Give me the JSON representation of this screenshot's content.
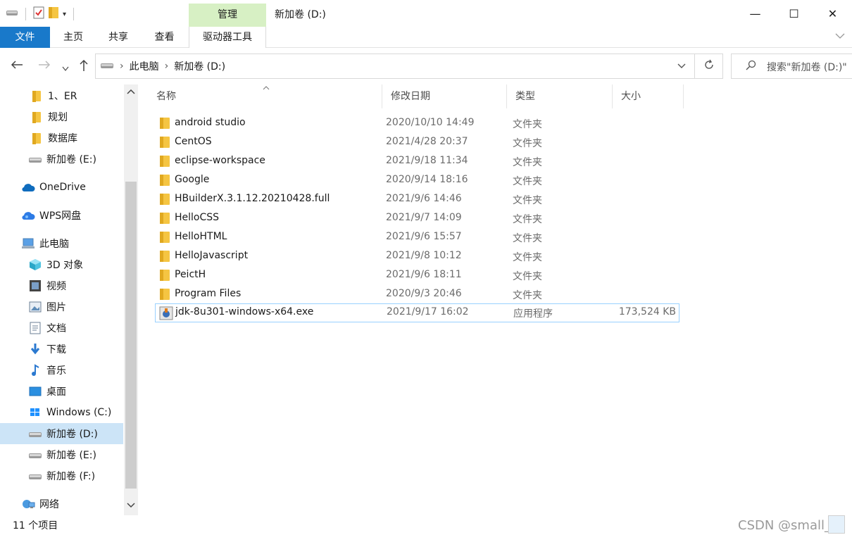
{
  "window": {
    "title": "新加卷 (D:)",
    "context_tab": "管理",
    "controls": {
      "minimize": "—",
      "maximize": "☐",
      "close": "✕"
    }
  },
  "ribbon": {
    "tabs": [
      "文件",
      "主页",
      "共享",
      "查看",
      "驱动器工具"
    ],
    "expand_icon": "chevron-down-icon"
  },
  "address": {
    "crumbs": [
      "此电脑",
      "新加卷 (D:)"
    ],
    "search_placeholder": "搜索\"新加卷 (D:)\""
  },
  "sidebar": {
    "items": [
      {
        "label": "1、ER",
        "icon": "folder-icon"
      },
      {
        "label": "规划",
        "icon": "folder-icon"
      },
      {
        "label": "数据库",
        "icon": "folder-icon"
      },
      {
        "label": "新加卷 (E:)",
        "icon": "drive-icon"
      },
      {
        "label": "OneDrive",
        "icon": "cloud-icon"
      },
      {
        "label": "WPS网盘",
        "icon": "wps-cloud-icon"
      },
      {
        "label": "此电脑",
        "icon": "computer-icon"
      },
      {
        "label": "3D 对象",
        "icon": "cube-icon"
      },
      {
        "label": "视频",
        "icon": "film-icon"
      },
      {
        "label": "图片",
        "icon": "picture-icon"
      },
      {
        "label": "文档",
        "icon": "document-icon"
      },
      {
        "label": "下载",
        "icon": "download-icon"
      },
      {
        "label": "音乐",
        "icon": "music-icon"
      },
      {
        "label": "桌面",
        "icon": "desktop-icon"
      },
      {
        "label": "Windows (C:)",
        "icon": "windows-drive-icon"
      },
      {
        "label": "新加卷 (D:)",
        "icon": "drive-icon"
      },
      {
        "label": "新加卷 (E:)",
        "icon": "drive-icon"
      },
      {
        "label": "新加卷 (F:)",
        "icon": "drive-icon"
      },
      {
        "label": "网络",
        "icon": "network-icon"
      }
    ],
    "selected_label": "新加卷 (D:)"
  },
  "columns": {
    "name": "名称",
    "modified": "修改日期",
    "type": "类型",
    "size": "大小"
  },
  "files": [
    {
      "name": "android studio",
      "modified": "2020/10/10 14:49",
      "type": "文件夹",
      "size": "",
      "icon": "folder-icon"
    },
    {
      "name": "CentOS",
      "modified": "2021/4/28 20:37",
      "type": "文件夹",
      "size": "",
      "icon": "folder-icon"
    },
    {
      "name": "eclipse-workspace",
      "modified": "2021/9/18 11:34",
      "type": "文件夹",
      "size": "",
      "icon": "folder-icon"
    },
    {
      "name": "Google",
      "modified": "2020/9/14 18:16",
      "type": "文件夹",
      "size": "",
      "icon": "folder-icon"
    },
    {
      "name": "HBuilderX.3.1.12.20210428.full",
      "modified": "2021/9/6 14:46",
      "type": "文件夹",
      "size": "",
      "icon": "folder-icon"
    },
    {
      "name": "HelloCSS",
      "modified": "2021/9/7 14:09",
      "type": "文件夹",
      "size": "",
      "icon": "folder-icon"
    },
    {
      "name": "HelloHTML",
      "modified": "2021/9/6 15:57",
      "type": "文件夹",
      "size": "",
      "icon": "folder-icon"
    },
    {
      "name": "HelloJavascript",
      "modified": "2021/9/8 10:12",
      "type": "文件夹",
      "size": "",
      "icon": "folder-icon"
    },
    {
      "name": "PeictH",
      "modified": "2021/9/6 18:11",
      "type": "文件夹",
      "size": "",
      "icon": "folder-icon"
    },
    {
      "name": "Program Files",
      "modified": "2020/9/3 20:46",
      "type": "文件夹",
      "size": "",
      "icon": "folder-icon"
    },
    {
      "name": "jdk-8u301-windows-x64.exe",
      "modified": "2021/9/17 16:02",
      "type": "应用程序",
      "size": "173,524 KB",
      "icon": "installer-icon"
    }
  ],
  "selected_file": "jdk-8u301-windows-x64.exe",
  "status": {
    "count": "11 个项目",
    "watermark": "CSDN @small_琵"
  },
  "colors": {
    "accent": "#1979ca",
    "manage_tab": "#d7f0c4",
    "selection": "#cce4f7",
    "row_selection_border": "#99d1ff"
  }
}
